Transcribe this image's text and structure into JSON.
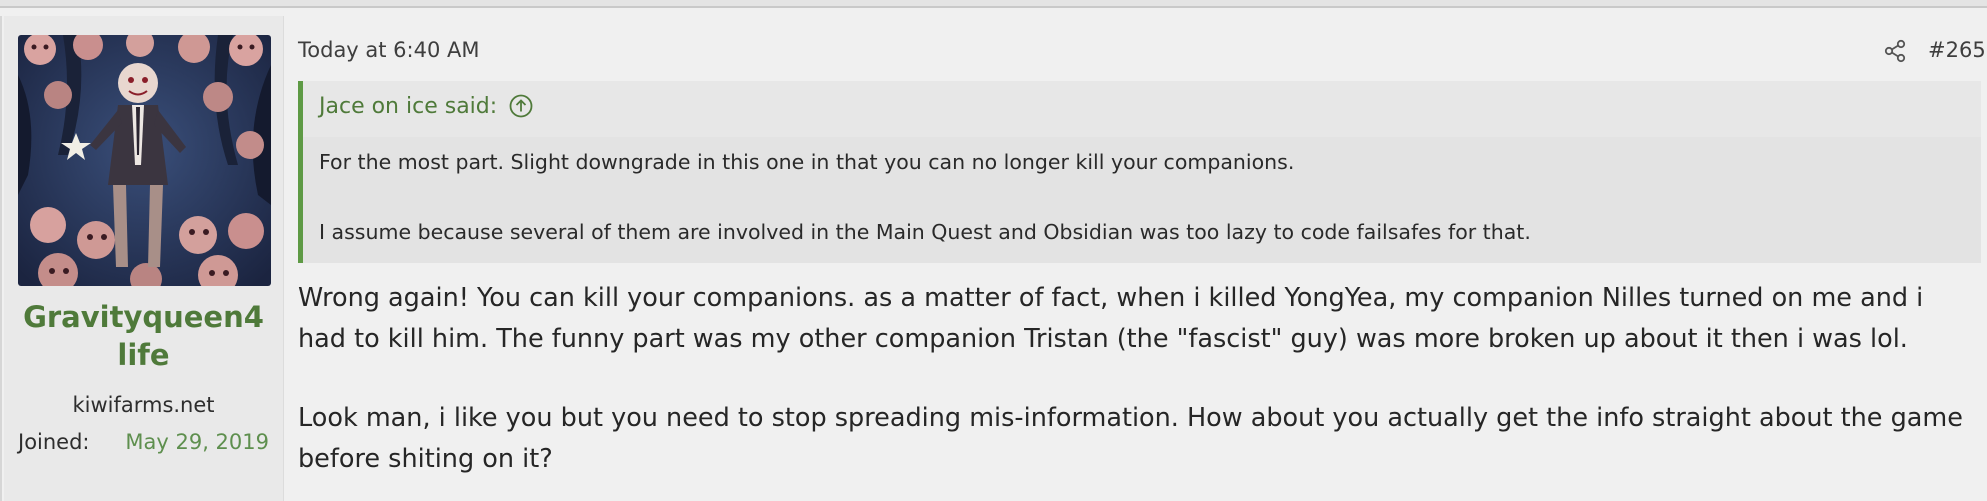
{
  "user": {
    "username": "Gravityqueen4life",
    "site": "kiwifarms.net",
    "joined_label": "Joined:",
    "joined_date": "May 29, 2019"
  },
  "post": {
    "timestamp": "Today at 6:40 AM",
    "number": "#265",
    "share_icon": "share-icon"
  },
  "quote": {
    "author": "Jace on ice said:",
    "author_icon": "arrow-up-circle-icon",
    "paragraphs": [
      "For the most part. Slight downgrade in this one in that you can no longer kill your companions.",
      "I assume because several of them are involved in the Main Quest and Obsidian was too lazy to code failsafes for that."
    ]
  },
  "body": {
    "paragraphs": [
      "Wrong again! You can kill your companions. as a matter of fact, when i killed YongYea, my companion Nilles turned on me and i had to kill him. The funny part was my other companion Tristan (the \"fascist\" guy) was more broken up about it then i was lol.",
      "Look man, i like you but you need to stop spreading mis-information. How about you actually get the info straight about the game before shiting on it?"
    ]
  },
  "colors": {
    "accent_green": "#4f7a3a",
    "quote_border": "#5e9a45",
    "background": "#f0f0f0"
  }
}
